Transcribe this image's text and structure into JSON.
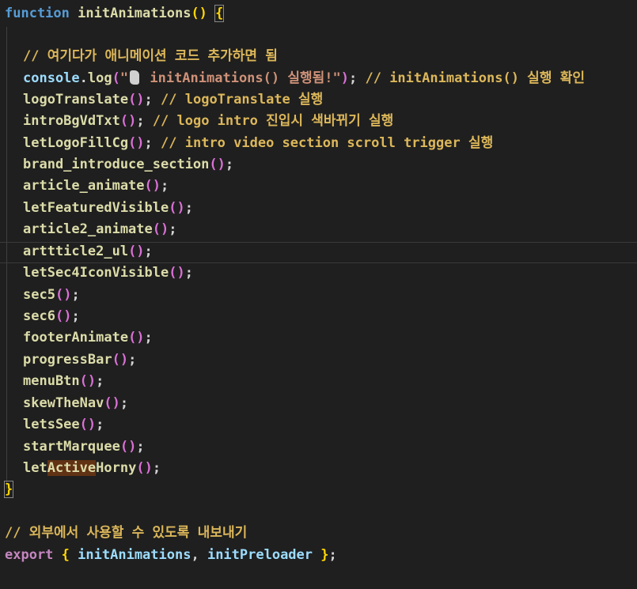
{
  "editor": {
    "theme_colors": {
      "background": "#1f1f1f",
      "keyword": "#569cd6",
      "function": "#dcdcaa",
      "variable": "#9cdcfe",
      "string": "#ce9178",
      "comment": "#6a9955",
      "bracket_level1": "#ffd700",
      "bracket_level2": "#da70d6",
      "highlight": "#613214"
    },
    "lines": {
      "l1": {
        "kw": "function",
        "name": "initAnimations"
      },
      "l3": {
        "comment": "// 여기다가 애니메이션 코드 추가하면 됨"
      },
      "l4": {
        "obj": "console",
        "method": "log",
        "str_prefix": "\"",
        "str_body": " initAnimations() 실행됨!\"",
        "comment": "// initAnimations() 실행 확인"
      },
      "l5": {
        "call": "logoTranslate",
        "comment": "// logoTranslate 실행"
      },
      "l6": {
        "call": "introBgVdTxt",
        "comment": "// logo intro 진입시 색바뀌기 실행"
      },
      "l7": {
        "call": "letLogoFillCg",
        "comment": "// intro video section scroll trigger 실행"
      },
      "l8": {
        "call": "brand_introduce_section"
      },
      "l9": {
        "call": "article_animate"
      },
      "l10": {
        "call": "letFeaturedVisible"
      },
      "l11": {
        "call": "article2_animate"
      },
      "l12": {
        "call": "arttticle2_ul"
      },
      "l13": {
        "call": "letSec4IconVisible"
      },
      "l14": {
        "call": "sec5"
      },
      "l15": {
        "call": "sec6"
      },
      "l16": {
        "call": "footerAnimate"
      },
      "l17": {
        "call": "progressBar"
      },
      "l18": {
        "call": "menuBtn"
      },
      "l19": {
        "call": "skewTheNav"
      },
      "l20": {
        "call": "letsSee"
      },
      "l21": {
        "call": "startMarquee"
      },
      "l22": {
        "call_pre": "let",
        "call_highlight": "Active",
        "call_post": "Horny"
      },
      "l25": {
        "comment": "// 외부에서 사용할 수 있도록 내보내기"
      },
      "l26": {
        "kw": "export",
        "item1": "initAnimations",
        "item2": "initPreloader"
      }
    }
  }
}
